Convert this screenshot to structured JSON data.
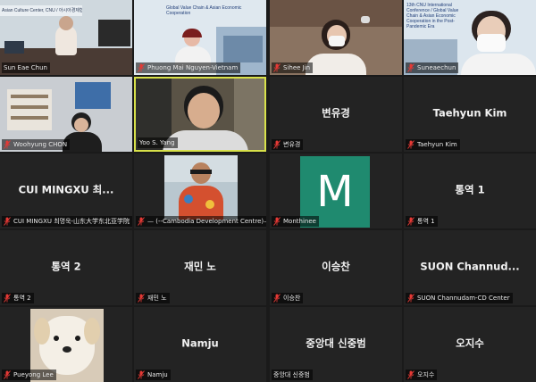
{
  "window": {
    "title": "Video Conference Gallery View"
  },
  "colors": {
    "tile_bg": "#232323",
    "active_border": "#d8e14a",
    "muted_mic": "#e53935",
    "avatar_m": "#1f8a6f"
  },
  "icons": {
    "mic": "mic-muted-icon"
  },
  "tiles": [
    {
      "label": "Sun Eae Chun",
      "muted": false,
      "slide_text": "Asian Culture Center, CNU / 아시아경제협력"
    },
    {
      "label": "Phuong Mai Nguyen-Vietnam",
      "muted": true,
      "slide_text": "Global Value Chain & Asian Economic Cooperation"
    },
    {
      "label": "Sihee Jin",
      "muted": true
    },
    {
      "label": "Suneaechun",
      "muted": true,
      "slide_text": "13th CNU International Conference / Global Value Chain & Asian Economic Cooperation in the Post-Pandemic Era"
    },
    {
      "label": "Woohyung CHON",
      "muted": true
    },
    {
      "label": "Yoo S. Yang",
      "muted": false,
      "active": true
    },
    {
      "label": "변유경",
      "name": "변유경",
      "muted": true
    },
    {
      "label": "Taehyun Kim",
      "name": "Taehyun Kim",
      "muted": true
    },
    {
      "label": "CUI MINGXU 최명욱-山东大学东北亚学院",
      "name": "CUI  MINGXU  최...",
      "muted": true
    },
    {
      "label": "— (--Cambodia Development Centre)— Da...",
      "muted": true
    },
    {
      "label": "Monthinee",
      "muted": true,
      "avatar_letter": "M"
    },
    {
      "label": "통역 1",
      "name": "통역 1",
      "muted": true
    },
    {
      "label": "통역 2",
      "name": "통역 2",
      "muted": true
    },
    {
      "label": "재민 노",
      "name": "재민 노",
      "muted": true
    },
    {
      "label": "이승찬",
      "name": "이승찬",
      "muted": true
    },
    {
      "label": "SUON  Channudam-CD Center",
      "name": "SUON  Channud...",
      "muted": true
    },
    {
      "label": "Pueyong Lee",
      "muted": true
    },
    {
      "label": "Namju",
      "name": "Namju",
      "muted": true
    },
    {
      "label": "중앙대 신중범",
      "name": "중앙대 신중범",
      "muted": false
    },
    {
      "label": "오지수",
      "name": "오지수",
      "muted": true
    }
  ]
}
